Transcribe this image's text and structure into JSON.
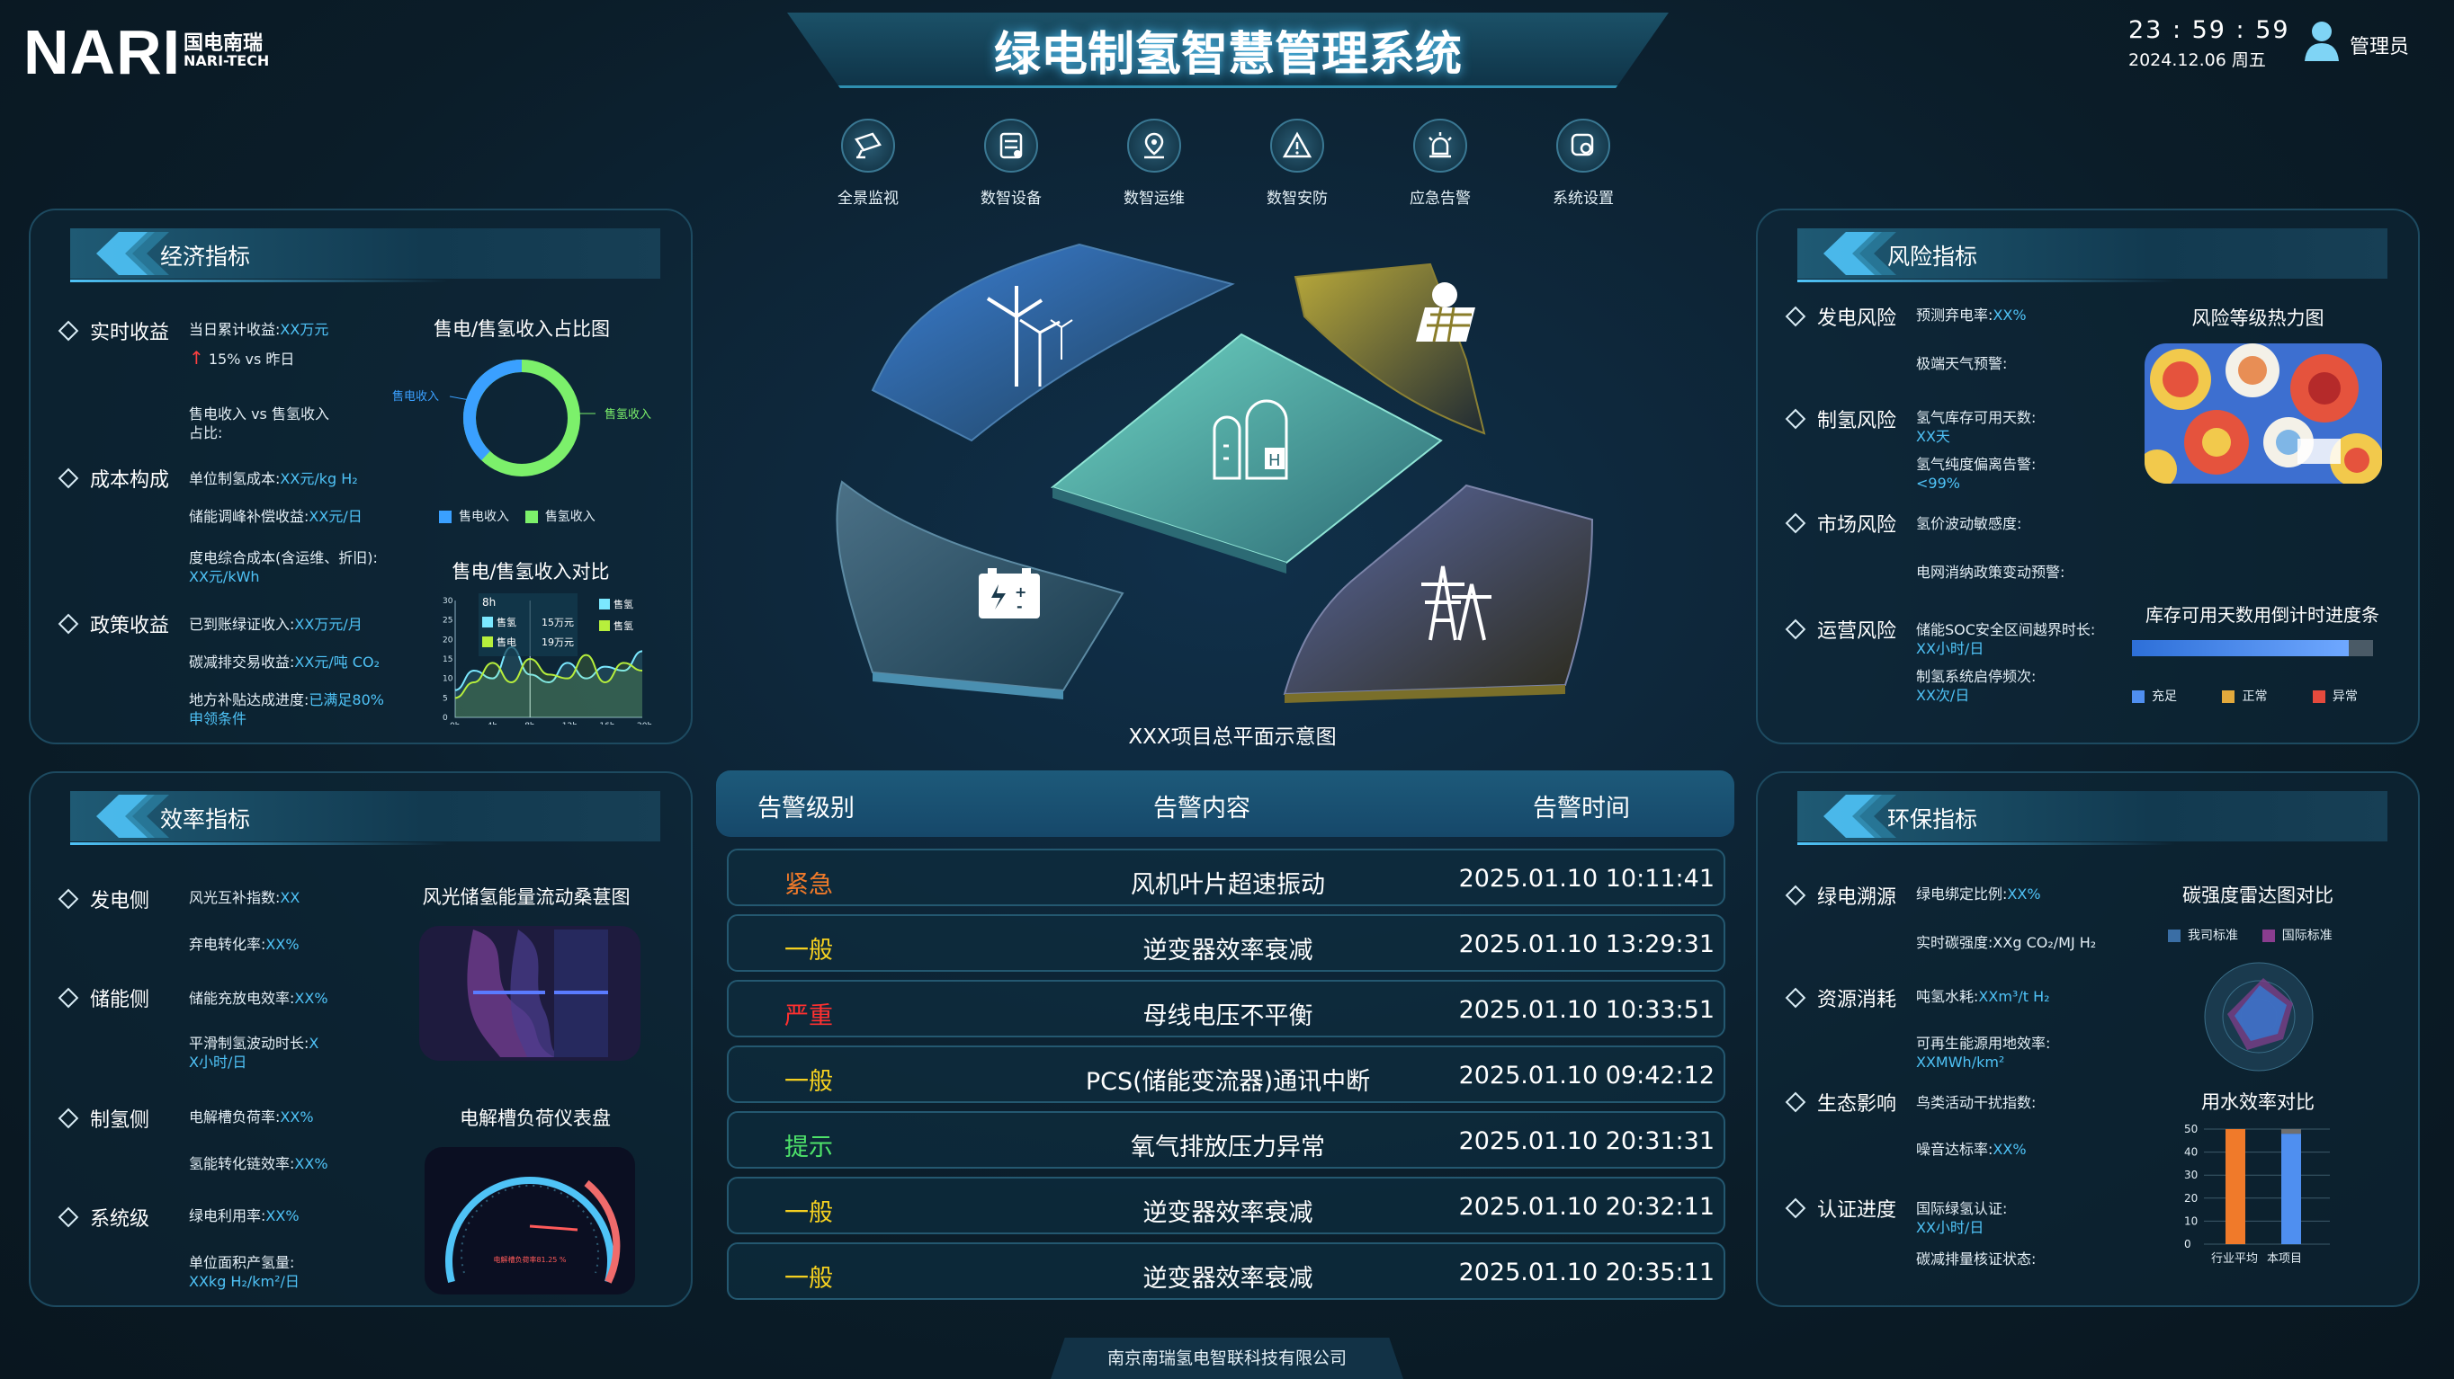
{
  "header": {
    "logo": "NARI",
    "logo_cn": "国电南瑞",
    "logo_en": "NARI-TECH",
    "title": "绿电制氢智慧管理系统",
    "time": "23 : 59 : 59",
    "date": "2024.12.06 周五",
    "user": "管理员"
  },
  "nav": [
    {
      "label": "全景监视",
      "icon": "monitor-icon"
    },
    {
      "label": "数智设备",
      "icon": "device-icon"
    },
    {
      "label": "数智运维",
      "icon": "maintenance-icon"
    },
    {
      "label": "数智安防",
      "icon": "security-icon"
    },
    {
      "label": "应急告警",
      "icon": "alarm-icon"
    },
    {
      "label": "系统设置",
      "icon": "settings-icon"
    }
  ],
  "economic": {
    "title": "经济指标",
    "realtime": {
      "label": "实时收益",
      "l1": "当日累计收益:",
      "v1": "XX万元",
      "l2": "15% vs 昨日",
      "l3": "售电收入 vs 售氢收入",
      "l4": "占比:"
    },
    "cost": {
      "label": "成本构成",
      "l1": "单位制氢成本:",
      "v1": "XX元/kg H₂",
      "l2": "储能调峰补偿收益:",
      "v2": "XX元/日",
      "l3": "度电综合成本(含运维、折旧):",
      "v3": "XX元/kWh"
    },
    "policy": {
      "label": "政策收益",
      "l1": "已到账绿证收入:",
      "v1": "XX万元/月",
      "l2": "碳减排交易收益:",
      "v2": "XX元/吨 CO₂",
      "l3": "地方补贴达成进度:",
      "v3": "已满足80%",
      "v3b": "申领条件"
    },
    "donut_title": "售电/售氢收入占比图",
    "donut_left": "售电收入",
    "donut_right": "售氢收入",
    "legend1": "售电收入",
    "legend2": "售氢收入",
    "compare_title": "售电/售氢收入对比",
    "tip_time": "8h",
    "tip_l1": "售氢",
    "tip_v1": "15万元",
    "tip_l2": "售电",
    "tip_v2": "19万元",
    "leg_a": "售氢",
    "leg_b": "售氢"
  },
  "chart_data": {
    "type": "line",
    "x": [
      "0h",
      "4h",
      "8h",
      "12h",
      "16h",
      "20h"
    ],
    "ylim": [
      0,
      30
    ],
    "yticks": [
      "0",
      "5",
      "10",
      "15",
      "20",
      "25",
      "30"
    ],
    "series": [
      {
        "values": [
          7,
          12,
          10,
          18,
          11,
          9,
          14,
          10,
          13,
          12,
          17
        ]
      },
      {
        "values": [
          5,
          9,
          14,
          9,
          15,
          11,
          10,
          16,
          9,
          14,
          12
        ]
      }
    ]
  },
  "efficiency": {
    "title": "效率指标",
    "gen": {
      "label": "发电侧",
      "l1": "风光互补指数:",
      "v1": "XX",
      "l2": "弃电转化率:",
      "v2": "XX%"
    },
    "storage": {
      "label": "储能侧",
      "l1": "储能充放电效率:",
      "v1": "XX%",
      "l2": "平滑制氢波动时长:",
      "v2": "X",
      "v2b": "X小时/日"
    },
    "h2": {
      "label": "制氢侧",
      "l1": "电解槽负荷率:",
      "v1": "XX%",
      "l2": "氢能转化链效率:",
      "v2": "XX%"
    },
    "sys": {
      "label": "系统级",
      "l1": "绿电利用率:",
      "v1": "XX%",
      "l2": "单位面积产氢量:",
      "v2": "XXkg H₂/km²/日"
    },
    "sankey_title": "风光储氢能量流动桑葚图",
    "gauge_title": "电解槽负荷仪表盘",
    "gauge_text": "电解槽负荷率81.25 %"
  },
  "center": {
    "caption": "XXX项目总平面示意图"
  },
  "alarms": {
    "h1": "告警级别",
    "h2": "告警内容",
    "h3": "告警时间",
    "rows": [
      {
        "level": "紧急",
        "color": "#f07a2a",
        "content": "风机叶片超速振动",
        "time": "2025.01.10 10:11:41"
      },
      {
        "level": "一般",
        "color": "#f5d020",
        "content": "逆变器效率衰减",
        "time": "2025.01.10 13:29:31"
      },
      {
        "level": "严重",
        "color": "#ff3030",
        "content": "母线电压不平衡",
        "time": "2025.01.10 10:33:51"
      },
      {
        "level": "一般",
        "color": "#f5d020",
        "content": "PCS(储能变流器)通讯中断",
        "time": "2025.01.10 09:42:12"
      },
      {
        "level": "提示",
        "color": "#4ee36a",
        "content": "氧气排放压力异常",
        "time": "2025.01.10 20:31:31"
      },
      {
        "level": "一般",
        "color": "#f5d020",
        "content": "逆变器效率衰减",
        "time": "2025.01.10 20:32:11"
      },
      {
        "level": "一般",
        "color": "#f5d020",
        "content": "逆变器效率衰减",
        "time": "2025.01.10 20:35:11"
      }
    ]
  },
  "risk": {
    "title": "风险指标",
    "gen": {
      "label": "发电风险",
      "l1": "预测弃电率:",
      "v1": "XX%",
      "l2": "极端天气预警:"
    },
    "h2": {
      "label": "制氢风险",
      "l1": "氢气库存可用天数:",
      "v1": "XX天",
      "l2": "氢气纯度偏离告警:",
      "v2": "<99%"
    },
    "market": {
      "label": "市场风险",
      "l1": "氢价波动敏感度:",
      "l2": "电网消纳政策变动预警:"
    },
    "ops": {
      "label": "运营风险",
      "l1": "储能SOC安全区间越界时长:",
      "v1": "XX小时/日",
      "l2": "制氢系统启停频次:",
      "v2": "XX次/日"
    },
    "heat_title": "风险等级热力图",
    "progress_title": "库存可用天数用倒计时进度条",
    "progress_value": 0.9,
    "leg1": "充足",
    "leg2": "正常",
    "leg3": "异常"
  },
  "env": {
    "title": "环保指标",
    "source": {
      "label": "绿电溯源",
      "l1": "绿电绑定比例:",
      "v1": "XX%",
      "l2": "实时碳强度:",
      "v2": "XXg CO₂/MJ H₂"
    },
    "resource": {
      "label": "资源消耗",
      "l1": "吨氢水耗:",
      "v1": "XXm³/t H₂",
      "l2": "可再生能源用地效率:",
      "v2": "XXMWh/km²"
    },
    "eco": {
      "label": "生态影响",
      "l1": "鸟类活动干扰指数:",
      "l2": "噪音达标率:",
      "v2": "XX%"
    },
    "cert": {
      "label": "认证进度",
      "l1": "国际绿氢认证:",
      "v1": "XX小时/日",
      "l2": "碳减排量核证状态:"
    },
    "radar_title": "碳强度雷达图对比",
    "radar_leg1": "我司标准",
    "radar_leg2": "国际标准",
    "water_title": "用水效率对比",
    "water_cats": [
      "行业平均",
      "本项目"
    ],
    "water_values": [
      50,
      48
    ],
    "water_yticks": [
      "0",
      "10",
      "20",
      "30",
      "40",
      "50"
    ]
  },
  "footer": "南京南瑞氢电智联科技有限公司"
}
